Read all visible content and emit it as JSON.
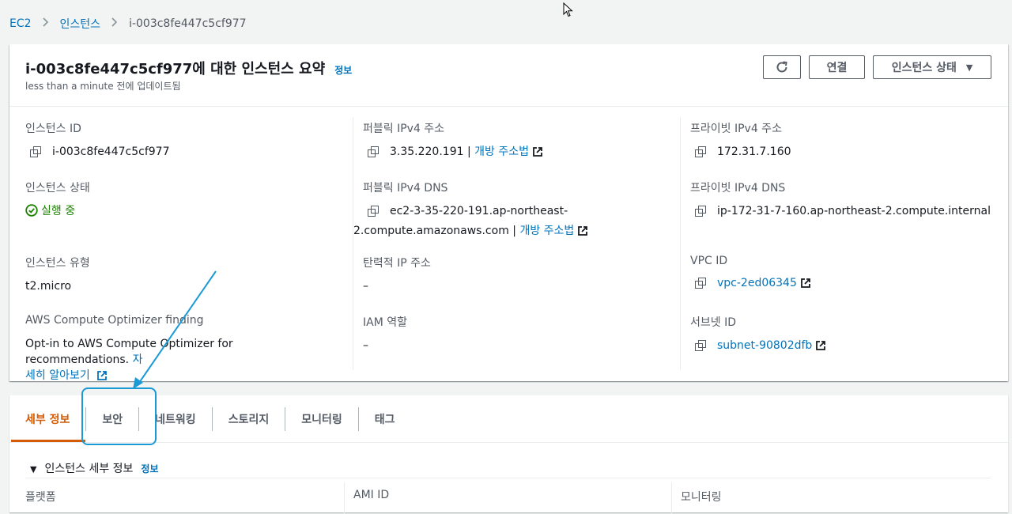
{
  "breadcrumb": {
    "items": [
      "EC2",
      "인스턴스"
    ],
    "current": "i-003c8fe447c5cf977"
  },
  "summary": {
    "title": "i-003c8fe447c5cf977에 대한 인스턴스 요약",
    "info": "정보",
    "updated": "less than a minute 전에 업데이트됨",
    "buttons": {
      "connect": "연결",
      "instance_state": "인스턴스 상태"
    },
    "fields": {
      "instance_id": {
        "label": "인스턴스 ID",
        "value": "i-003c8fe447c5cf977"
      },
      "public_ipv4": {
        "label": "퍼블릭 IPv4 주소",
        "value": "3.35.220.191",
        "link": "개방 주소법"
      },
      "private_ipv4": {
        "label": "프라이빗 IPv4 주소",
        "value": "172.31.7.160"
      },
      "instance_state": {
        "label": "인스턴스 상태",
        "value": "실행 중"
      },
      "public_dns": {
        "label": "퍼블릭 IPv4 DNS",
        "value_line1": "ec2-3-35-220-191.ap-northeast-",
        "value_line2": "2.compute.amazonaws.com",
        "link": "개방 주소법"
      },
      "private_dns": {
        "label": "프라이빗 IPv4 DNS",
        "value": "ip-172-31-7-160.ap-northeast-2.compute.internal"
      },
      "instance_type": {
        "label": "인스턴스 유형",
        "value": "t2.micro"
      },
      "elastic_ip": {
        "label": "탄력적 IP 주소",
        "value": "–"
      },
      "vpc_id": {
        "label": "VPC ID",
        "value": "vpc-2ed06345"
      },
      "optimizer": {
        "label": "AWS Compute Optimizer finding",
        "text": "Opt-in to AWS Compute Optimizer for recommendations.",
        "link_a": "자",
        "link_b": "세히 알아보기"
      },
      "iam_role": {
        "label": "IAM 역할",
        "value": "–"
      },
      "subnet_id": {
        "label": "서브넷 ID",
        "value": "subnet-90802dfb"
      }
    }
  },
  "tabs": [
    "세부 정보",
    "보안",
    "네트워킹",
    "스토리지",
    "모니터링",
    "태그"
  ],
  "details": {
    "section_title": "인스턴스 세부 정보",
    "info": "정보",
    "labels": [
      "플랫폼",
      "AMI ID",
      "모니터링"
    ]
  },
  "colors": {
    "link": "#0073bb",
    "active_tab": "#d45b07",
    "running": "#1d8102",
    "annotation": "#1b9ad6"
  },
  "icons": [
    "chevron-right-icon",
    "refresh-icon",
    "caret-down-icon",
    "copy-icon",
    "external-link-icon",
    "check-circle-icon",
    "cursor-icon",
    "arrow-annotation"
  ]
}
